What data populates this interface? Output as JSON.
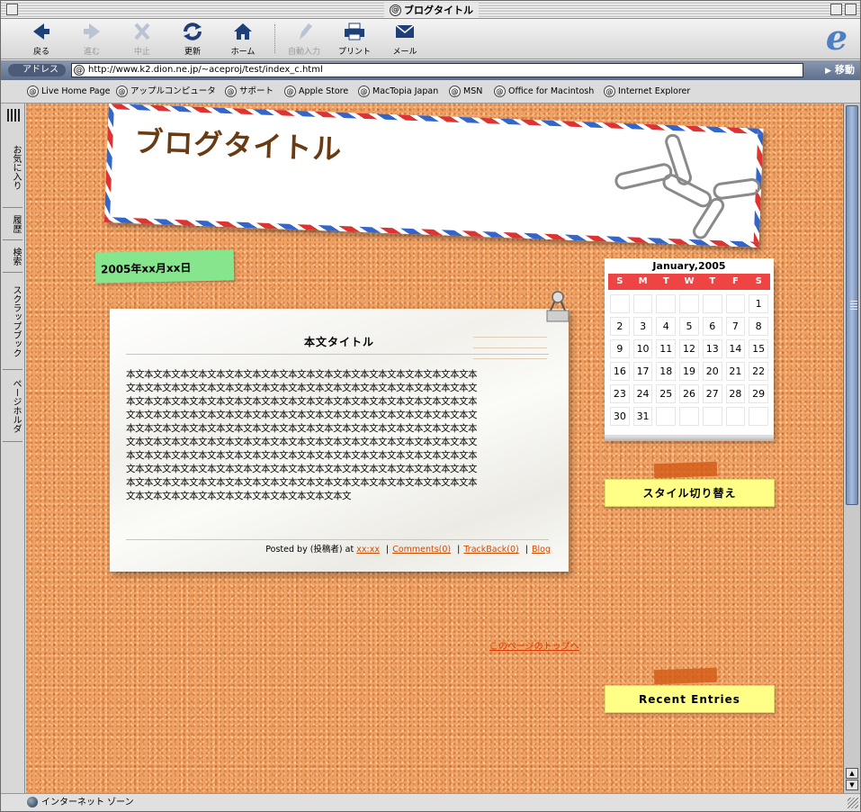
{
  "window": {
    "title": "ブログタイトル"
  },
  "toolbar": {
    "buttons": [
      {
        "label": "戻る"
      },
      {
        "label": "進む"
      },
      {
        "label": "中止"
      },
      {
        "label": "更新"
      },
      {
        "label": "ホーム"
      },
      {
        "label": "自動入力"
      },
      {
        "label": "プリント"
      },
      {
        "label": "メール"
      }
    ]
  },
  "address": {
    "label": "アドレス",
    "url": "http://www.k2.dion.ne.jp/~aceproj/test/index_c.html",
    "go_label": "移動"
  },
  "favorites": [
    "Live Home Page",
    "アップルコンピュータ",
    "サポート",
    "Apple Store",
    "MacTopia Japan",
    "MSN",
    "Office for Macintosh",
    "Internet Explorer"
  ],
  "side_tabs": [
    "お気に入り",
    "履歴",
    "検索",
    "スクラップブック",
    "ページホルダ"
  ],
  "status": {
    "text": "インターネット ゾーン"
  },
  "blog": {
    "title": "ブログタイトル",
    "date": "2005年xx月xx日",
    "post": {
      "title": "本文タイトル",
      "body": "本文本文本文本文本文本文本文本文本文本文本文本文本文本文本文本文本文本文本文本文本文本文本文本文本文本文本文本文本文本文本文本文本文本文本文本文本文本文本文本文本文本文本文本文本文本文本文本文本文本文本文本文本文本文本文本文本文本文本文本文本文本文本文本文本文本文本文本文本文本文本文本文本文本文本文本文本文本文本文本文本文本文本文本文本文本文本文本文本文本文本文本文本文本文本文本文本文本文本文本文本文本文本文本文本文本文本文本文本文本文本文本文本文本文本文本文本文本文本文本文本文本文本文本文本文本文本文本文本文本文本文本文本文本文本文本文本文本文本文本文本文本文本文本文本文本文本文本文本文本文本文本文本文本文本文本文本文本文本文本文本文本文本文本文本文本文本文本文本文本文本文本文本文本文本文本文本文本文本文本文本文本文本文本文本文本文本文本文",
      "posted_by": "Posted by (投稿者) at",
      "time": "xx:xx",
      "comments": "Comments(0)",
      "trackback": "TrackBack(0)",
      "blog_link": "Blog"
    },
    "top_link": "このページのトップへ",
    "calendar": {
      "title": "January,2005",
      "weekdays": [
        "S",
        "M",
        "T",
        "W",
        "T",
        "F",
        "S"
      ],
      "days": [
        "",
        "",
        "",
        "",
        "",
        "",
        "1",
        "2",
        "3",
        "4",
        "5",
        "6",
        "7",
        "8",
        "9",
        "10",
        "11",
        "12",
        "13",
        "14",
        "15",
        "16",
        "17",
        "18",
        "19",
        "20",
        "21",
        "22",
        "23",
        "24",
        "25",
        "26",
        "27",
        "28",
        "29",
        "30",
        "31",
        "",
        "",
        "",
        "",
        ""
      ]
    },
    "sidebar": {
      "style_switch": "スタイル切り替え",
      "recent_entries": "Recent Entries"
    }
  }
}
